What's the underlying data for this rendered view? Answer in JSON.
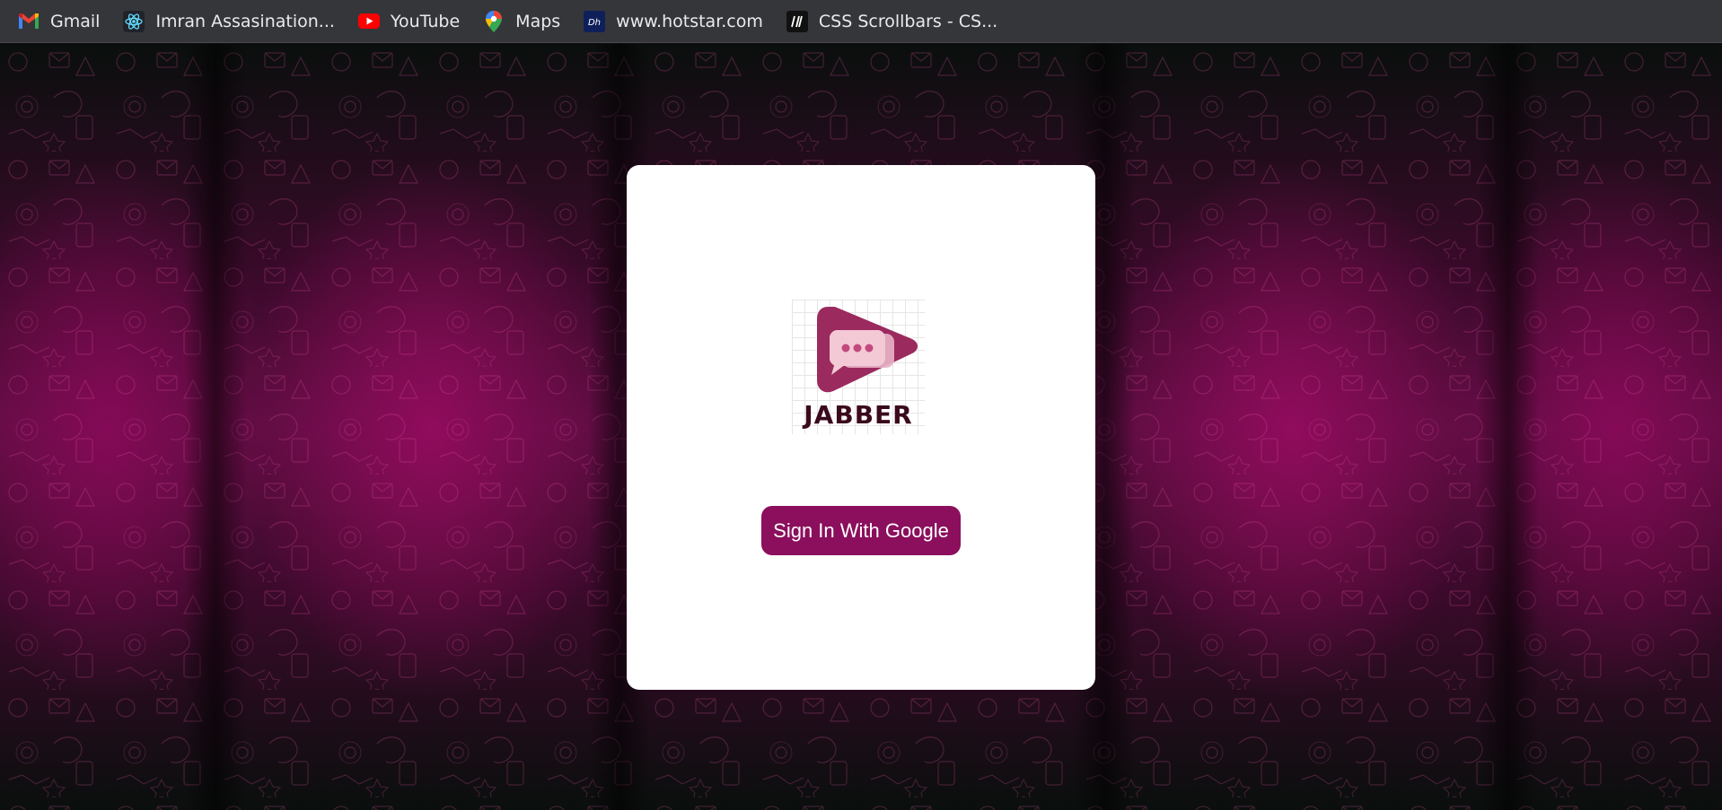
{
  "bookmarks": [
    {
      "label": "Gmail",
      "icon": "gmail-icon"
    },
    {
      "label": "Imran Assasination...",
      "icon": "react-icon"
    },
    {
      "label": "YouTube",
      "icon": "youtube-icon"
    },
    {
      "label": "Maps",
      "icon": "maps-pin-icon"
    },
    {
      "label": "www.hotstar.com",
      "icon": "hotstar-icon"
    },
    {
      "label": "CSS Scrollbars - CS...",
      "icon": "css-scrollbars-icon"
    }
  ],
  "app": {
    "logo_text": "JABBER",
    "signin_label": "Sign In With Google"
  },
  "colors": {
    "brand": "#8b0f5c",
    "logo_mark": "#9b2a5e",
    "background_accent": "#5a0d40"
  }
}
